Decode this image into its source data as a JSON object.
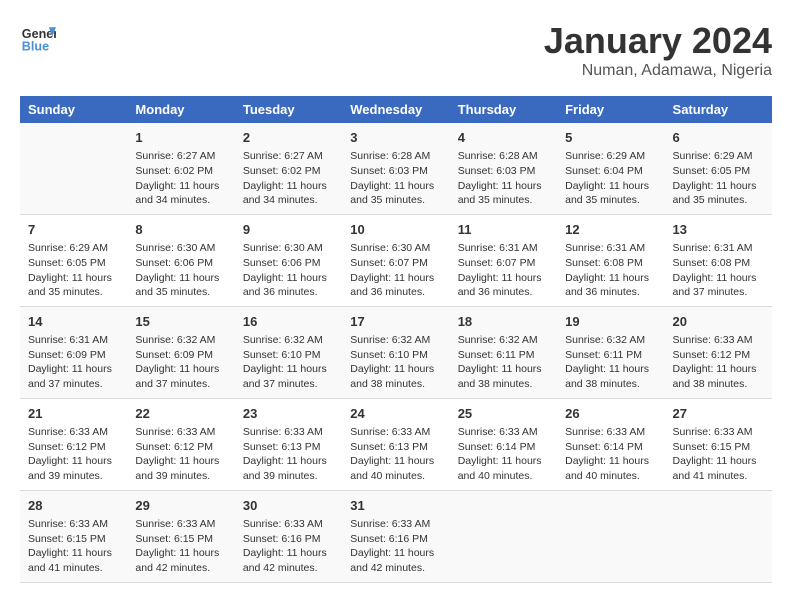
{
  "header": {
    "logo_line1": "General",
    "logo_line2": "Blue",
    "title": "January 2024",
    "subtitle": "Numan, Adamawa, Nigeria"
  },
  "days_of_week": [
    "Sunday",
    "Monday",
    "Tuesday",
    "Wednesday",
    "Thursday",
    "Friday",
    "Saturday"
  ],
  "weeks": [
    [
      {
        "num": "",
        "info": ""
      },
      {
        "num": "1",
        "info": "Sunrise: 6:27 AM\nSunset: 6:02 PM\nDaylight: 11 hours\nand 34 minutes."
      },
      {
        "num": "2",
        "info": "Sunrise: 6:27 AM\nSunset: 6:02 PM\nDaylight: 11 hours\nand 34 minutes."
      },
      {
        "num": "3",
        "info": "Sunrise: 6:28 AM\nSunset: 6:03 PM\nDaylight: 11 hours\nand 35 minutes."
      },
      {
        "num": "4",
        "info": "Sunrise: 6:28 AM\nSunset: 6:03 PM\nDaylight: 11 hours\nand 35 minutes."
      },
      {
        "num": "5",
        "info": "Sunrise: 6:29 AM\nSunset: 6:04 PM\nDaylight: 11 hours\nand 35 minutes."
      },
      {
        "num": "6",
        "info": "Sunrise: 6:29 AM\nSunset: 6:05 PM\nDaylight: 11 hours\nand 35 minutes."
      }
    ],
    [
      {
        "num": "7",
        "info": "Sunrise: 6:29 AM\nSunset: 6:05 PM\nDaylight: 11 hours\nand 35 minutes."
      },
      {
        "num": "8",
        "info": "Sunrise: 6:30 AM\nSunset: 6:06 PM\nDaylight: 11 hours\nand 35 minutes."
      },
      {
        "num": "9",
        "info": "Sunrise: 6:30 AM\nSunset: 6:06 PM\nDaylight: 11 hours\nand 36 minutes."
      },
      {
        "num": "10",
        "info": "Sunrise: 6:30 AM\nSunset: 6:07 PM\nDaylight: 11 hours\nand 36 minutes."
      },
      {
        "num": "11",
        "info": "Sunrise: 6:31 AM\nSunset: 6:07 PM\nDaylight: 11 hours\nand 36 minutes."
      },
      {
        "num": "12",
        "info": "Sunrise: 6:31 AM\nSunset: 6:08 PM\nDaylight: 11 hours\nand 36 minutes."
      },
      {
        "num": "13",
        "info": "Sunrise: 6:31 AM\nSunset: 6:08 PM\nDaylight: 11 hours\nand 37 minutes."
      }
    ],
    [
      {
        "num": "14",
        "info": "Sunrise: 6:31 AM\nSunset: 6:09 PM\nDaylight: 11 hours\nand 37 minutes."
      },
      {
        "num": "15",
        "info": "Sunrise: 6:32 AM\nSunset: 6:09 PM\nDaylight: 11 hours\nand 37 minutes."
      },
      {
        "num": "16",
        "info": "Sunrise: 6:32 AM\nSunset: 6:10 PM\nDaylight: 11 hours\nand 37 minutes."
      },
      {
        "num": "17",
        "info": "Sunrise: 6:32 AM\nSunset: 6:10 PM\nDaylight: 11 hours\nand 38 minutes."
      },
      {
        "num": "18",
        "info": "Sunrise: 6:32 AM\nSunset: 6:11 PM\nDaylight: 11 hours\nand 38 minutes."
      },
      {
        "num": "19",
        "info": "Sunrise: 6:32 AM\nSunset: 6:11 PM\nDaylight: 11 hours\nand 38 minutes."
      },
      {
        "num": "20",
        "info": "Sunrise: 6:33 AM\nSunset: 6:12 PM\nDaylight: 11 hours\nand 38 minutes."
      }
    ],
    [
      {
        "num": "21",
        "info": "Sunrise: 6:33 AM\nSunset: 6:12 PM\nDaylight: 11 hours\nand 39 minutes."
      },
      {
        "num": "22",
        "info": "Sunrise: 6:33 AM\nSunset: 6:12 PM\nDaylight: 11 hours\nand 39 minutes."
      },
      {
        "num": "23",
        "info": "Sunrise: 6:33 AM\nSunset: 6:13 PM\nDaylight: 11 hours\nand 39 minutes."
      },
      {
        "num": "24",
        "info": "Sunrise: 6:33 AM\nSunset: 6:13 PM\nDaylight: 11 hours\nand 40 minutes."
      },
      {
        "num": "25",
        "info": "Sunrise: 6:33 AM\nSunset: 6:14 PM\nDaylight: 11 hours\nand 40 minutes."
      },
      {
        "num": "26",
        "info": "Sunrise: 6:33 AM\nSunset: 6:14 PM\nDaylight: 11 hours\nand 40 minutes."
      },
      {
        "num": "27",
        "info": "Sunrise: 6:33 AM\nSunset: 6:15 PM\nDaylight: 11 hours\nand 41 minutes."
      }
    ],
    [
      {
        "num": "28",
        "info": "Sunrise: 6:33 AM\nSunset: 6:15 PM\nDaylight: 11 hours\nand 41 minutes."
      },
      {
        "num": "29",
        "info": "Sunrise: 6:33 AM\nSunset: 6:15 PM\nDaylight: 11 hours\nand 42 minutes."
      },
      {
        "num": "30",
        "info": "Sunrise: 6:33 AM\nSunset: 6:16 PM\nDaylight: 11 hours\nand 42 minutes."
      },
      {
        "num": "31",
        "info": "Sunrise: 6:33 AM\nSunset: 6:16 PM\nDaylight: 11 hours\nand 42 minutes."
      },
      {
        "num": "",
        "info": ""
      },
      {
        "num": "",
        "info": ""
      },
      {
        "num": "",
        "info": ""
      }
    ]
  ]
}
